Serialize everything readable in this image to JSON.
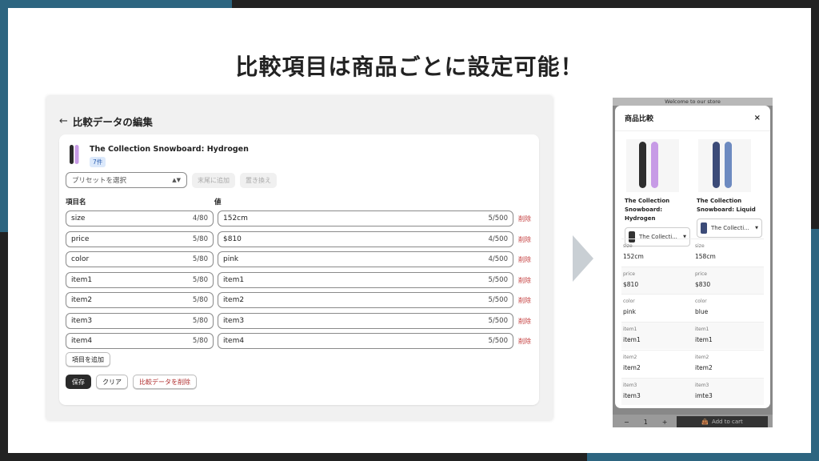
{
  "headline": "比較項目は商品ごとに設定可能！",
  "admin": {
    "title": "比較データの編集",
    "product_name": "The Collection Snowboard: Hydrogen",
    "badge": "7件",
    "preset_placeholder": "プリセットを選択",
    "append_label": "末尾に追加",
    "replace_label": "置き換え",
    "col_name_label": "項目名",
    "col_value_label": "値",
    "delete_label": "削除",
    "rows": [
      {
        "name": "size",
        "name_count": "4/80",
        "value": "152cm",
        "value_count": "5/500"
      },
      {
        "name": "price",
        "name_count": "5/80",
        "value": "$810",
        "value_count": "4/500"
      },
      {
        "name": "color",
        "name_count": "5/80",
        "value": "pink",
        "value_count": "4/500"
      },
      {
        "name": "item1",
        "name_count": "5/80",
        "value": "item1",
        "value_count": "5/500"
      },
      {
        "name": "item2",
        "name_count": "5/80",
        "value": "item2",
        "value_count": "5/500"
      },
      {
        "name": "item3",
        "name_count": "5/80",
        "value": "item3",
        "value_count": "5/500"
      },
      {
        "name": "item4",
        "name_count": "5/80",
        "value": "item4",
        "value_count": "5/500"
      }
    ],
    "add_item_label": "項目を追加",
    "save_label": "保存",
    "clear_label": "クリア",
    "delete_data_label": "比較データを削除"
  },
  "store": {
    "banner": "Welcome to our store",
    "modal_title": "商品比較",
    "close_glyph": "×",
    "products": [
      {
        "name_line1": "The Collection",
        "name_line2": "Snowboard: Hydrogen",
        "select_label": "The Collecti..."
      },
      {
        "name_line1": "The Collection",
        "name_line2": "Snowboard: Liquid",
        "select_label": "The Collecti..."
      }
    ],
    "attributes": [
      {
        "key": "size",
        "a": "152cm",
        "b": "158cm"
      },
      {
        "key": "price",
        "a": "$810",
        "b": "$830"
      },
      {
        "key": "color",
        "a": "pink",
        "b": "blue"
      },
      {
        "key": "item1",
        "a": "item1",
        "b": "item1"
      },
      {
        "key": "item2",
        "a": "item2",
        "b": "item2"
      },
      {
        "key": "item3",
        "a": "item3",
        "b": "imte3"
      }
    ],
    "qty_minus": "−",
    "qty_value": "1",
    "qty_plus": "+",
    "add_to_cart": "Add to cart"
  },
  "colors": {
    "teal": "#2d6580",
    "delete_red": "#c43c3c",
    "badge_blue": "#dce9fb"
  }
}
